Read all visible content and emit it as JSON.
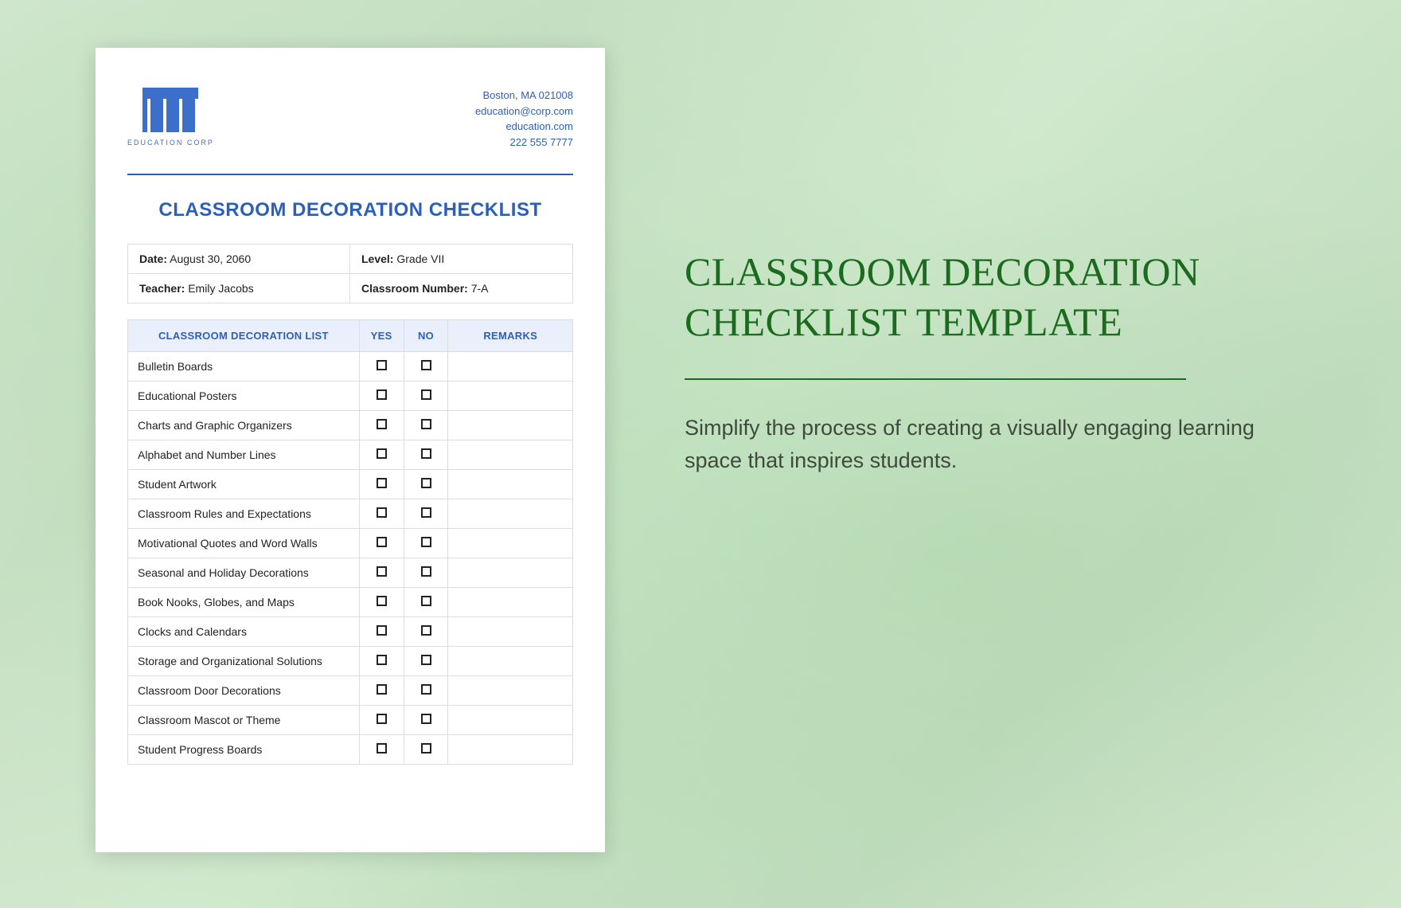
{
  "document": {
    "logo_text": "EDUCATION CORP",
    "contact": {
      "address": "Boston, MA 021008",
      "email": "education@corp.com",
      "website": "education.com",
      "phone": "222 555 7777"
    },
    "title": "CLASSROOM DECORATION CHECKLIST",
    "info": {
      "date_label": "Date:",
      "date_value": " August 30, 2060",
      "level_label": "Level:",
      "level_value": " Grade VII",
      "teacher_label": "Teacher:",
      "teacher_value": " Emily Jacobs",
      "classroom_label": "Classroom Number:",
      "classroom_value": " 7-A"
    },
    "table_headers": {
      "list": "CLASSROOM DECORATION LIST",
      "yes": "YES",
      "no": "NO",
      "remarks": "REMARKS"
    },
    "items": [
      "Bulletin Boards",
      "Educational Posters",
      "Charts and Graphic Organizers",
      "Alphabet and Number Lines",
      "Student Artwork",
      "Classroom Rules and Expectations",
      "Motivational Quotes and Word Walls",
      "Seasonal and Holiday Decorations",
      "Book Nooks, Globes, and Maps",
      "Clocks and Calendars",
      "Storage and Organizational Solutions",
      "Classroom Door Decorations",
      "Classroom Mascot or Theme",
      "Student Progress Boards"
    ]
  },
  "promo": {
    "title_line1": "CLASSROOM DECORATION",
    "title_line2": "CHECKLIST TEMPLATE",
    "sub": "Simplify the process of creating a visually engaging learning space that inspires students."
  }
}
